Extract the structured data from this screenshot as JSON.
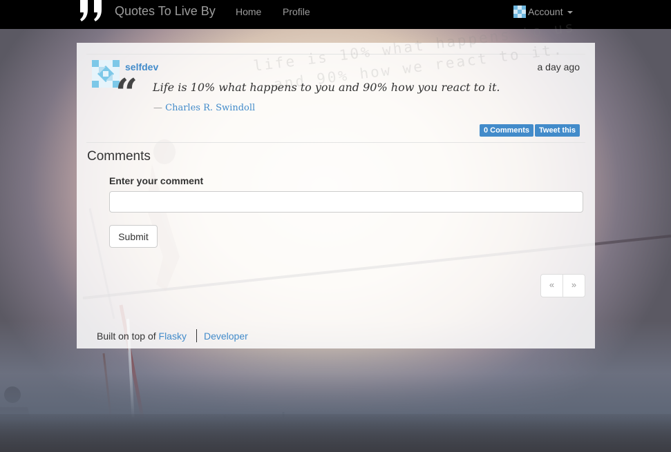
{
  "navbar": {
    "brand": "Quotes To Live By",
    "links": [
      {
        "label": "Home"
      },
      {
        "label": "Profile"
      }
    ],
    "account_label": "Account"
  },
  "post": {
    "username": "selfdev",
    "timestamp": "a day ago",
    "quote_mark": "“",
    "quote": "Life is 10% what happens to you and 90% how you react to it.",
    "author_dash": "—",
    "author": "Charles R. Swindoll",
    "comments_button": "0 Comments",
    "tweet_button": "Tweet this",
    "watermark_lines": [
      "life is 10% what happens to us",
      "and 90% how we react to it."
    ]
  },
  "comments": {
    "title": "Comments",
    "input_label": "Enter your comment",
    "input_value": "",
    "submit_label": "Submit"
  },
  "pagination": {
    "prev": "«",
    "next": "»"
  },
  "footer": {
    "built_text": "Built on top of",
    "flasky_link": "Flasky",
    "developer_link": "Developer"
  },
  "colors": {
    "navbar_bg": "#000000",
    "link": "#428bca",
    "button": "#428bca"
  }
}
